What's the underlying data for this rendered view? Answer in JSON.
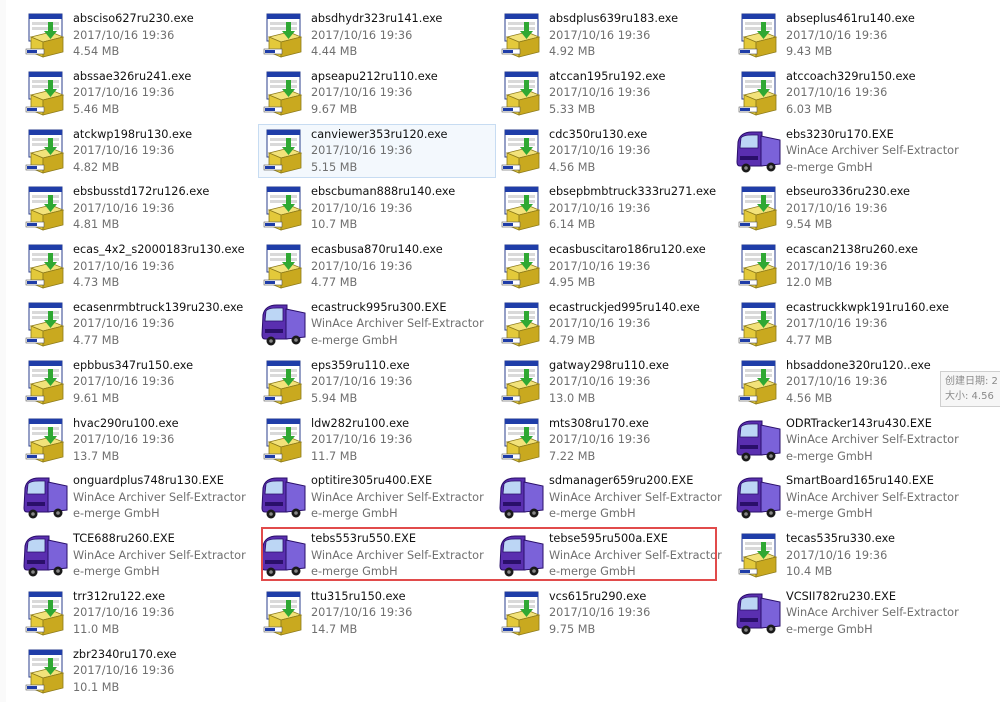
{
  "window": {
    "tooltip": {
      "line1": "创建日期: 2",
      "line2": "大小: 4.56"
    }
  },
  "files": [
    {
      "name": "absciso627ru230.exe",
      "line2": "2017/10/16 19:36",
      "line3": "4.54 MB",
      "icon": "installer-icon"
    },
    {
      "name": "absdhydr323ru141.exe",
      "line2": "2017/10/16 19:36",
      "line3": "4.44 MB",
      "icon": "installer-icon"
    },
    {
      "name": "absdplus639ru183.exe",
      "line2": "2017/10/16 19:36",
      "line3": "4.92 MB",
      "icon": "installer-icon"
    },
    {
      "name": "abseplus461ru140.exe",
      "line2": "2017/10/16 19:36",
      "line3": "9.43 MB",
      "icon": "installer-icon"
    },
    {
      "name": "abssae326ru241.exe",
      "line2": "2017/10/16 19:36",
      "line3": "5.46 MB",
      "icon": "installer-icon"
    },
    {
      "name": "apseapu212ru110.exe",
      "line2": "2017/10/16 19:36",
      "line3": "9.67 MB",
      "icon": "installer-icon"
    },
    {
      "name": "atccan195ru192.exe",
      "line2": "2017/10/16 19:36",
      "line3": "5.33 MB",
      "icon": "installer-icon"
    },
    {
      "name": "atccoach329ru150.exe",
      "line2": "2017/10/16 19:36",
      "line3": "6.03 MB",
      "icon": "installer-icon"
    },
    {
      "name": "atckwp198ru130.exe",
      "line2": "2017/10/16 19:36",
      "line3": "4.82 MB",
      "icon": "installer-icon"
    },
    {
      "name": "canviewer353ru120.exe",
      "line2": "2017/10/16 19:36",
      "line3": "5.15 MB",
      "icon": "installer-icon",
      "selected": true
    },
    {
      "name": "cdc350ru130.exe",
      "line2": "2017/10/16 19:36",
      "line3": "4.56 MB",
      "icon": "installer-icon"
    },
    {
      "name": "ebs3230ru170.EXE",
      "line2": "WinAce Archiver Self-Extractor",
      "line3": "e-merge GmbH",
      "icon": "truck-icon"
    },
    {
      "name": "ebsbusstd172ru126.exe",
      "line2": "2017/10/16 19:36",
      "line3": "4.81 MB",
      "icon": "installer-icon"
    },
    {
      "name": "ebscbuman888ru140.exe",
      "line2": "2017/10/16 19:36",
      "line3": "10.7 MB",
      "icon": "installer-icon"
    },
    {
      "name": "ebsepbmbtruck333ru271.exe",
      "line2": "2017/10/16 19:36",
      "line3": "6.14 MB",
      "icon": "installer-icon"
    },
    {
      "name": "ebseuro336ru230.exe",
      "line2": "2017/10/16 19:36",
      "line3": "9.54 MB",
      "icon": "installer-icon"
    },
    {
      "name": "ecas_4x2_s2000183ru130.exe",
      "line2": "2017/10/16 19:36",
      "line3": "4.73 MB",
      "icon": "installer-icon"
    },
    {
      "name": "ecasbusa870ru140.exe",
      "line2": "2017/10/16 19:36",
      "line3": "4.77 MB",
      "icon": "installer-icon"
    },
    {
      "name": "ecasbuscitaro186ru120.exe",
      "line2": "2017/10/16 19:36",
      "line3": "4.95 MB",
      "icon": "installer-icon"
    },
    {
      "name": "ecascan2138ru260.exe",
      "line2": "2017/10/16 19:36",
      "line3": "12.0 MB",
      "icon": "installer-icon"
    },
    {
      "name": "ecasenrmbtruck139ru230.exe",
      "line2": "2017/10/16 19:36",
      "line3": "4.77 MB",
      "icon": "installer-icon"
    },
    {
      "name": "ecastruck995ru300.EXE",
      "line2": "WinAce Archiver Self-Extractor",
      "line3": "e-merge GmbH",
      "icon": "truck-icon"
    },
    {
      "name": "ecastruckjed995ru140.exe",
      "line2": "2017/10/16 19:36",
      "line3": "4.79 MB",
      "icon": "installer-icon"
    },
    {
      "name": "ecastruckkwpk191ru160.exe",
      "line2": "2017/10/16 19:36",
      "line3": "4.77 MB",
      "icon": "installer-icon"
    },
    {
      "name": "epbbus347ru150.exe",
      "line2": "2017/10/16 19:36",
      "line3": "9.61 MB",
      "icon": "installer-icon"
    },
    {
      "name": "eps359ru110.exe",
      "line2": "2017/10/16 19:36",
      "line3": "5.94 MB",
      "icon": "installer-icon"
    },
    {
      "name": "gatway298ru110.exe",
      "line2": "2017/10/16 19:36",
      "line3": "13.0 MB",
      "icon": "installer-icon"
    },
    {
      "name": "hbsaddone320ru120..exe",
      "line2": "2017/10/16 19:36",
      "line3": "4.56 MB",
      "icon": "installer-icon"
    },
    {
      "name": "hvac290ru100.exe",
      "line2": "2017/10/16 19:36",
      "line3": "13.7 MB",
      "icon": "installer-icon"
    },
    {
      "name": "ldw282ru100.exe",
      "line2": "2017/10/16 19:36",
      "line3": "11.7 MB",
      "icon": "installer-icon"
    },
    {
      "name": "mts308ru170.exe",
      "line2": "2017/10/16 19:36",
      "line3": "7.22 MB",
      "icon": "installer-icon"
    },
    {
      "name": "ODRTracker143ru430.EXE",
      "line2": "WinAce Archiver Self-Extractor",
      "line3": "e-merge GmbH",
      "icon": "truck-icon"
    },
    {
      "name": "onguardplus748ru130.EXE",
      "line2": "WinAce Archiver Self-Extractor",
      "line3": "e-merge GmbH",
      "icon": "truck-icon"
    },
    {
      "name": "optitire305ru400.EXE",
      "line2": "WinAce Archiver Self-Extractor",
      "line3": "e-merge GmbH",
      "icon": "truck-icon"
    },
    {
      "name": "sdmanager659ru200.EXE",
      "line2": "WinAce Archiver Self-Extractor",
      "line3": "e-merge GmbH",
      "icon": "truck-icon"
    },
    {
      "name": "SmartBoard165ru140.EXE",
      "line2": "WinAce Archiver Self-Extractor",
      "line3": "e-merge GmbH",
      "icon": "truck-icon"
    },
    {
      "name": "TCE688ru260.EXE",
      "line2": "WinAce Archiver Self-Extractor",
      "line3": "e-merge GmbH",
      "icon": "truck-icon"
    },
    {
      "name": "tebs553ru550.EXE",
      "line2": "WinAce Archiver Self-Extractor",
      "line3": "e-merge GmbH",
      "icon": "truck-icon"
    },
    {
      "name": "tebse595ru500a.EXE",
      "line2": "WinAce Archiver Self-Extractor",
      "line3": "e-merge GmbH",
      "icon": "truck-icon"
    },
    {
      "name": "tecas535ru330.exe",
      "line2": "2017/10/16 19:36",
      "line3": "10.4 MB",
      "icon": "installer-icon"
    },
    {
      "name": "trr312ru122.exe",
      "line2": "2017/10/16 19:36",
      "line3": "11.0 MB",
      "icon": "installer-icon"
    },
    {
      "name": "ttu315ru150.exe",
      "line2": "2017/10/16 19:36",
      "line3": "14.7 MB",
      "icon": "installer-icon"
    },
    {
      "name": "vcs615ru290.exe",
      "line2": "2017/10/16 19:36",
      "line3": "9.75 MB",
      "icon": "installer-icon"
    },
    {
      "name": "VCSII782ru230.EXE",
      "line2": "WinAce Archiver Self-Extractor",
      "line3": "e-merge GmbH",
      "icon": "truck-icon"
    },
    {
      "name": "zbr2340ru170.exe",
      "line2": "2017/10/16 19:36",
      "line3": "10.1 MB",
      "icon": "installer-icon"
    }
  ]
}
